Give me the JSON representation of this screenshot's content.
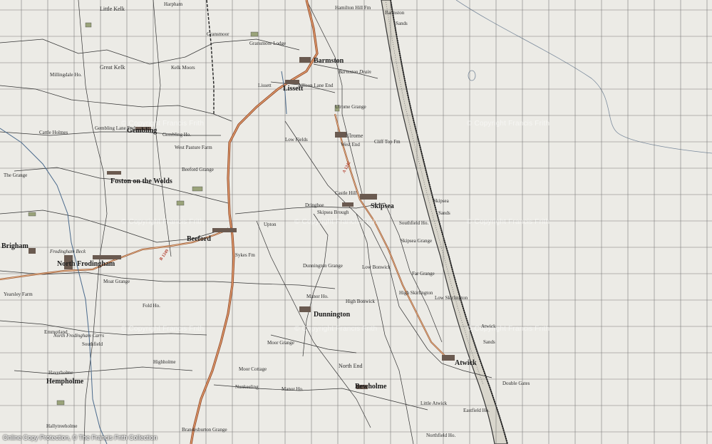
{
  "map": {
    "towns": {
      "beeford": "Beeford",
      "north_frodingham": "North Frodingham",
      "atwick": "Atwick",
      "skipsea": "Skipsea",
      "dunnington": "Dunnington",
      "bewholme": "Bewholme",
      "gembling": "Gembling",
      "foston": "Foston on the Wolds",
      "lissett": "Lissett",
      "barmston": "Barmston",
      "ulrome": "Ulrome",
      "brigham": "Brigham",
      "hempholme": "Hempholme",
      "great_kelk": "Great Kelk",
      "little_kelk": "Little Kelk",
      "north_end": "North End"
    },
    "labels": [
      {
        "id": "harpham",
        "text": "Harpham"
      },
      {
        "id": "gransmoor",
        "text": "Gransmoor"
      },
      {
        "id": "gransmoor-lodge",
        "text": "Gransmoor Lodge"
      },
      {
        "id": "hamilton-hill",
        "text": "Hamilton Hill Fm"
      },
      {
        "id": "barmston-sands",
        "text": "Sands"
      },
      {
        "id": "barmston-label",
        "text": "Barmston"
      },
      {
        "id": "allison-lane",
        "text": "Allison Lane End"
      },
      {
        "id": "barmston-drain",
        "text": "Barmston Drain"
      },
      {
        "id": "ulrome-grange",
        "text": "Ulrome Grange"
      },
      {
        "id": "west-end",
        "text": "West End"
      },
      {
        "id": "cliff-top",
        "text": "Cliff Top Fm"
      },
      {
        "id": "low-fields",
        "text": "Low Fields"
      },
      {
        "id": "skipsea-sands",
        "text": "Skipsea"
      },
      {
        "id": "skipsea-sands2",
        "text": "Sands"
      },
      {
        "id": "castle",
        "text": "Castle Hill"
      },
      {
        "id": "skipsea-brough",
        "text": "Skipsea Brough"
      },
      {
        "id": "southfield",
        "text": "Southfield Ho."
      },
      {
        "id": "skipsea-grange",
        "text": "Skipsea Grange"
      },
      {
        "id": "far-grange",
        "text": "Far Grange"
      },
      {
        "id": "low-bonwick",
        "text": "Low Bonwick"
      },
      {
        "id": "high-bonwick",
        "text": "High Bonwick"
      },
      {
        "id": "dunnington-grange",
        "text": "Dunnington Grange"
      },
      {
        "id": "manor-ho",
        "text": "Manor Ho."
      },
      {
        "id": "moor-grange",
        "text": "Moor Grange"
      },
      {
        "id": "moor-cottage",
        "text": "Moor Cottage"
      },
      {
        "id": "nunkeeling",
        "text": "Nunkeeling"
      },
      {
        "id": "little-atwick",
        "text": "Little Atwick"
      },
      {
        "id": "eastfield",
        "text": "Eastfield Ho."
      },
      {
        "id": "double-gates",
        "text": "Double Gates"
      },
      {
        "id": "atwick-sands",
        "text": "Atwick"
      },
      {
        "id": "atwick-sands2",
        "text": "Sands"
      },
      {
        "id": "northfield",
        "text": "Northfield Ho."
      },
      {
        "id": "high-skirlington",
        "text": "High Skirlington"
      },
      {
        "id": "low-skirlington",
        "text": "Low Skirlington"
      },
      {
        "id": "gembling-ho",
        "text": "Gembling Ho."
      },
      {
        "id": "gembling-lane-end",
        "text": "Gembling Lane End"
      },
      {
        "id": "west-pasture",
        "text": "West Pasture Farm"
      },
      {
        "id": "beeford-grange",
        "text": "Beeford Grange"
      },
      {
        "id": "the-grange",
        "text": "The Grange"
      },
      {
        "id": "cattle-holmes",
        "text": "Cattle Holmes"
      },
      {
        "id": "frodingham-beck",
        "text": "Frodingham Beck"
      },
      {
        "id": "yearsley",
        "text": "Yearsley Farm"
      },
      {
        "id": "fold-ho",
        "text": "Fold Ho."
      },
      {
        "id": "moat-grange",
        "text": "Moat Grange"
      },
      {
        "id": "brandesburton",
        "text": "Brandesburton Grange"
      },
      {
        "id": "hallytreeholme",
        "text": "Hallytreeholme"
      },
      {
        "id": "haverholme",
        "text": "Haverholme"
      },
      {
        "id": "manor-ho2",
        "text": "Manor Ho."
      },
      {
        "id": "highholme",
        "text": "Highholme"
      },
      {
        "id": "millingdale",
        "text": "Millingdale Ho."
      },
      {
        "id": "kelk-moors",
        "text": "Kelk Moors"
      },
      {
        "id": "sykes",
        "text": "Sykes Fm"
      },
      {
        "id": "upton",
        "text": "Upton"
      },
      {
        "id": "dringhoe",
        "text": "Dringhoe"
      },
      {
        "id": "cattle-farm",
        "text": "Lissett"
      },
      {
        "id": "southfield-fr",
        "text": "Southfield"
      },
      {
        "id": "north-frod-carrs",
        "text": "North Frodingham Carrs"
      },
      {
        "id": "emmotland",
        "text": "Emmotland"
      }
    ],
    "road_number": "A 1242",
    "road_number2": "B 1249",
    "watermarks": [
      "© Copyright Francis Frith",
      "© Copyright Francis Frith",
      "© Copyright Francis Frith",
      "© Copyright Francis Frith",
      "© Copyright Francis Frith",
      "© Copyright Francis Frith",
      "© Copyright Francis Frith",
      "© Copyright Francis Frith"
    ],
    "footer": "Online Copy Protection, © The Francis Frith Collection"
  }
}
